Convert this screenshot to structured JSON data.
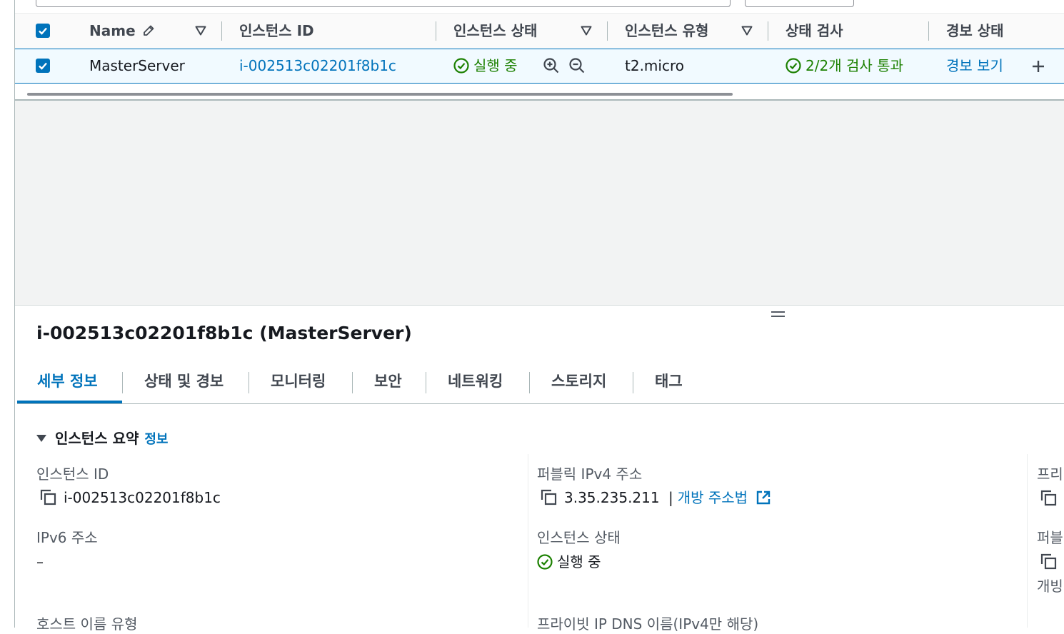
{
  "table": {
    "columns": {
      "name": "Name",
      "instance_id": "인스턴스 ID",
      "instance_state": "인스턴스 상태",
      "instance_type": "인스턴스 유형",
      "status_check": "상태 검사",
      "alarm_status": "경보 상태"
    },
    "rows": [
      {
        "name": "MasterServer",
        "instance_id": "i-002513c02201f8b1c",
        "instance_state": "실행 중",
        "instance_type": "t2.micro",
        "status_check": "2/2개 검사 통과",
        "alarm_status": "경보 보기"
      }
    ]
  },
  "detail": {
    "title": "i-002513c02201f8b1c (MasterServer)",
    "tabs": [
      "세부 정보",
      "상태 및 경보",
      "모니터링",
      "보안",
      "네트워킹",
      "스토리지",
      "태그"
    ],
    "active_tab": "세부 정보",
    "section": {
      "title": "인스턴스 요약",
      "info_link": "정보"
    },
    "fields": {
      "instance_id_label": "인스턴스 ID",
      "instance_id_value": "i-002513c02201f8b1c",
      "ipv6_label": "IPv6 주소",
      "ipv6_value": "–",
      "hostname_type_label": "호스트 이름 유형",
      "public_ipv4_label": "퍼블릭 IPv4 주소",
      "public_ipv4_value": "3.35.235.211",
      "public_ipv4_separator": "|",
      "public_ipv4_link": "개방 주소법",
      "instance_state_label": "인스턴스 상태",
      "instance_state_value": "실행 중",
      "private_dns_label": "프라이빗 IP DNS 이름(IPv4만 해당)",
      "col3_label1": "프리",
      "col3_label2": "퍼블",
      "col3_link": "개빙"
    }
  },
  "colors": {
    "accent": "#0073bb",
    "success": "#1d8102",
    "selected_row_bg": "#f1faff"
  }
}
